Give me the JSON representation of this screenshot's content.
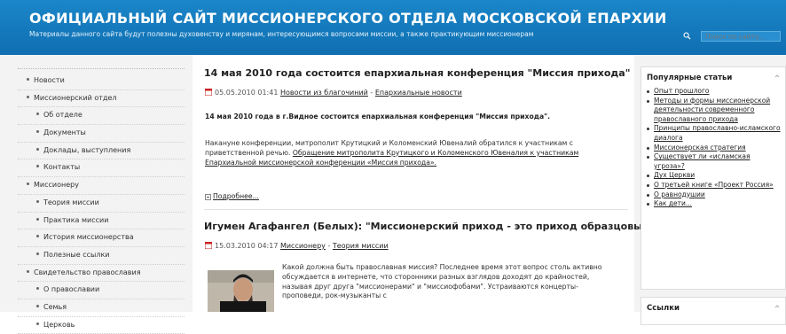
{
  "header": {
    "title": "ОФИЦИАЛЬНЫЙ САЙТ МИССИОНЕРСКОГО ОТДЕЛА МОСКОВСКОЙ ЕПАРХИИ",
    "subtitle": "Материалы данного сайта будут полезны духовенству и мирянам, интересующимся вопросами миссии, а также практикующим миссионерам",
    "search_placeholder": "Поиск по сайту..."
  },
  "nav": {
    "items": [
      {
        "label": "Новости",
        "level": 1
      },
      {
        "label": "Миссионерский отдел",
        "level": 1
      },
      {
        "label": "Об отделе",
        "level": 2
      },
      {
        "label": "Документы",
        "level": 2
      },
      {
        "label": "Доклады, выступления",
        "level": 2
      },
      {
        "label": "Контакты",
        "level": 2
      },
      {
        "label": "Миссионеру",
        "level": 1
      },
      {
        "label": "Теория миссии",
        "level": 2
      },
      {
        "label": "Практика миссии",
        "level": 2
      },
      {
        "label": "История миссионерства",
        "level": 2
      },
      {
        "label": "Полезные ссылки",
        "level": 2
      },
      {
        "label": "Свидетельство православия",
        "level": 1
      },
      {
        "label": "О православии",
        "level": 2
      },
      {
        "label": "Семья",
        "level": 2
      },
      {
        "label": "Церковь",
        "level": 2
      }
    ]
  },
  "articles": [
    {
      "title": "14 мая 2010 года состоится епархиальная конференция \"Миссия прихода\"",
      "date": "05.05.2010 01:41",
      "category": "Новости из благочиний",
      "sep": " - ",
      "subcategory": "Епархиальные новости",
      "lead": "14 мая 2010 года в г.Видное состоится епархиальная конференция \"Миссия прихода\".",
      "body_text": "Накануне конференции, митрополит Крутицкий и Коломенский Ювеналий обратился к участникам с приветственной речью.",
      "body_link": "Обращение митрополита Крутицкого и Коломенского Ювеналия к участникам Епархиальной миссионерской конференции «Миссия прихода».",
      "more": "Подробнее..."
    },
    {
      "title": "Игумен Агафангел (Белых): \"Миссионерский приход - это приход образцовый\"",
      "date": "15.03.2010 04:17",
      "category": "Миссионеру",
      "sep": " - ",
      "subcategory": "Теория миссии",
      "excerpt": "Какой должна быть православная миссия? Последнее время этот вопрос столь активно обсуждается в интернете, что сторонники разных взглядов доходят до крайностей, называя друг друга \"миссионерами\" и \"миссиофобами\". Устраиваются концерты-проповеди, рок-музыканты с"
    }
  ],
  "sidebar": {
    "popular_title": "Популярные статьи",
    "popular_items": [
      "Опыт прошлого",
      "Методы и формы миссионерской деятельности современного православного прихода",
      "Принципы православно-исламского диалога",
      "Миссионерская стратегия",
      "Существует ли «исламская угроза»?",
      "Дух Церкви",
      "О третьей книге «Проект Россия»",
      "О равнодушии",
      "Как дети..."
    ],
    "links_title": "Ссылки"
  }
}
